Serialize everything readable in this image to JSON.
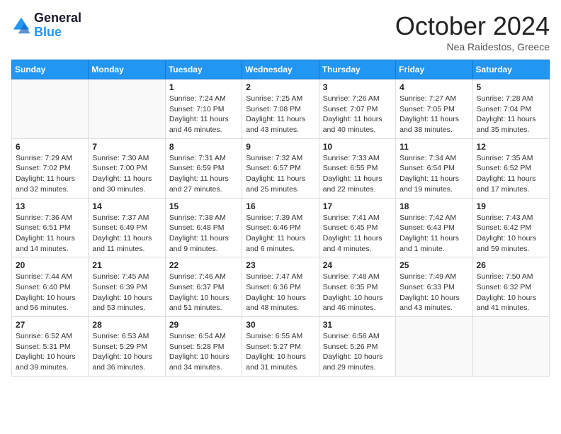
{
  "header": {
    "logo_general": "General",
    "logo_blue": "Blue",
    "month": "October 2024",
    "location": "Nea Raidestos, Greece"
  },
  "days_of_week": [
    "Sunday",
    "Monday",
    "Tuesday",
    "Wednesday",
    "Thursday",
    "Friday",
    "Saturday"
  ],
  "weeks": [
    [
      {
        "day": "",
        "info": ""
      },
      {
        "day": "",
        "info": ""
      },
      {
        "day": "1",
        "sunrise": "7:24 AM",
        "sunset": "7:10 PM",
        "daylight": "11 hours and 46 minutes."
      },
      {
        "day": "2",
        "sunrise": "7:25 AM",
        "sunset": "7:08 PM",
        "daylight": "11 hours and 43 minutes."
      },
      {
        "day": "3",
        "sunrise": "7:26 AM",
        "sunset": "7:07 PM",
        "daylight": "11 hours and 40 minutes."
      },
      {
        "day": "4",
        "sunrise": "7:27 AM",
        "sunset": "7:05 PM",
        "daylight": "11 hours and 38 minutes."
      },
      {
        "day": "5",
        "sunrise": "7:28 AM",
        "sunset": "7:04 PM",
        "daylight": "11 hours and 35 minutes."
      }
    ],
    [
      {
        "day": "6",
        "sunrise": "7:29 AM",
        "sunset": "7:02 PM",
        "daylight": "11 hours and 32 minutes."
      },
      {
        "day": "7",
        "sunrise": "7:30 AM",
        "sunset": "7:00 PM",
        "daylight": "11 hours and 30 minutes."
      },
      {
        "day": "8",
        "sunrise": "7:31 AM",
        "sunset": "6:59 PM",
        "daylight": "11 hours and 27 minutes."
      },
      {
        "day": "9",
        "sunrise": "7:32 AM",
        "sunset": "6:57 PM",
        "daylight": "11 hours and 25 minutes."
      },
      {
        "day": "10",
        "sunrise": "7:33 AM",
        "sunset": "6:55 PM",
        "daylight": "11 hours and 22 minutes."
      },
      {
        "day": "11",
        "sunrise": "7:34 AM",
        "sunset": "6:54 PM",
        "daylight": "11 hours and 19 minutes."
      },
      {
        "day": "12",
        "sunrise": "7:35 AM",
        "sunset": "6:52 PM",
        "daylight": "11 hours and 17 minutes."
      }
    ],
    [
      {
        "day": "13",
        "sunrise": "7:36 AM",
        "sunset": "6:51 PM",
        "daylight": "11 hours and 14 minutes."
      },
      {
        "day": "14",
        "sunrise": "7:37 AM",
        "sunset": "6:49 PM",
        "daylight": "11 hours and 11 minutes."
      },
      {
        "day": "15",
        "sunrise": "7:38 AM",
        "sunset": "6:48 PM",
        "daylight": "11 hours and 9 minutes."
      },
      {
        "day": "16",
        "sunrise": "7:39 AM",
        "sunset": "6:46 PM",
        "daylight": "11 hours and 6 minutes."
      },
      {
        "day": "17",
        "sunrise": "7:41 AM",
        "sunset": "6:45 PM",
        "daylight": "11 hours and 4 minutes."
      },
      {
        "day": "18",
        "sunrise": "7:42 AM",
        "sunset": "6:43 PM",
        "daylight": "11 hours and 1 minute."
      },
      {
        "day": "19",
        "sunrise": "7:43 AM",
        "sunset": "6:42 PM",
        "daylight": "10 hours and 59 minutes."
      }
    ],
    [
      {
        "day": "20",
        "sunrise": "7:44 AM",
        "sunset": "6:40 PM",
        "daylight": "10 hours and 56 minutes."
      },
      {
        "day": "21",
        "sunrise": "7:45 AM",
        "sunset": "6:39 PM",
        "daylight": "10 hours and 53 minutes."
      },
      {
        "day": "22",
        "sunrise": "7:46 AM",
        "sunset": "6:37 PM",
        "daylight": "10 hours and 51 minutes."
      },
      {
        "day": "23",
        "sunrise": "7:47 AM",
        "sunset": "6:36 PM",
        "daylight": "10 hours and 48 minutes."
      },
      {
        "day": "24",
        "sunrise": "7:48 AM",
        "sunset": "6:35 PM",
        "daylight": "10 hours and 46 minutes."
      },
      {
        "day": "25",
        "sunrise": "7:49 AM",
        "sunset": "6:33 PM",
        "daylight": "10 hours and 43 minutes."
      },
      {
        "day": "26",
        "sunrise": "7:50 AM",
        "sunset": "6:32 PM",
        "daylight": "10 hours and 41 minutes."
      }
    ],
    [
      {
        "day": "27",
        "sunrise": "6:52 AM",
        "sunset": "5:31 PM",
        "daylight": "10 hours and 39 minutes."
      },
      {
        "day": "28",
        "sunrise": "6:53 AM",
        "sunset": "5:29 PM",
        "daylight": "10 hours and 36 minutes."
      },
      {
        "day": "29",
        "sunrise": "6:54 AM",
        "sunset": "5:28 PM",
        "daylight": "10 hours and 34 minutes."
      },
      {
        "day": "30",
        "sunrise": "6:55 AM",
        "sunset": "5:27 PM",
        "daylight": "10 hours and 31 minutes."
      },
      {
        "day": "31",
        "sunrise": "6:56 AM",
        "sunset": "5:26 PM",
        "daylight": "10 hours and 29 minutes."
      },
      {
        "day": "",
        "info": ""
      },
      {
        "day": "",
        "info": ""
      }
    ]
  ]
}
